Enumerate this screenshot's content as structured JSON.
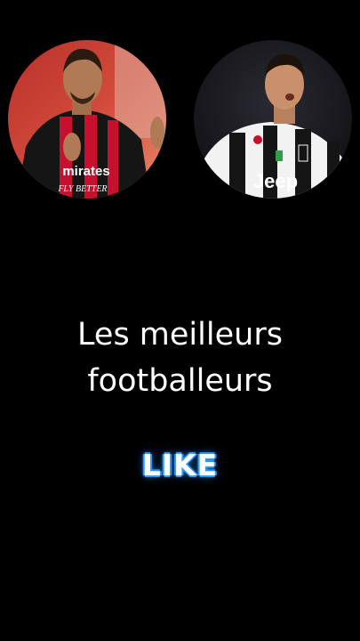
{
  "avatars": [
    {
      "name": "avatar-left",
      "shirt_text_line1": "mirates",
      "shirt_text_line2": "FLY BETTER",
      "colors": {
        "background": "#c83a2e",
        "shirt_red": "#c8102e",
        "shirt_black": "#141414",
        "skin": "#b07a55"
      }
    },
    {
      "name": "avatar-right",
      "shirt_text": "Jeep",
      "colors": {
        "background": "#1c1c22",
        "shirt_white": "#f2f2f2",
        "shirt_black": "#151515",
        "skin": "#c9906c"
      }
    }
  ],
  "caption": {
    "line1": "Les meilleurs",
    "line2": "footballeurs"
  },
  "like_label": "LIKE",
  "colors": {
    "background": "#000000",
    "text": "#ffffff",
    "like_glow": "#2f9bff"
  }
}
